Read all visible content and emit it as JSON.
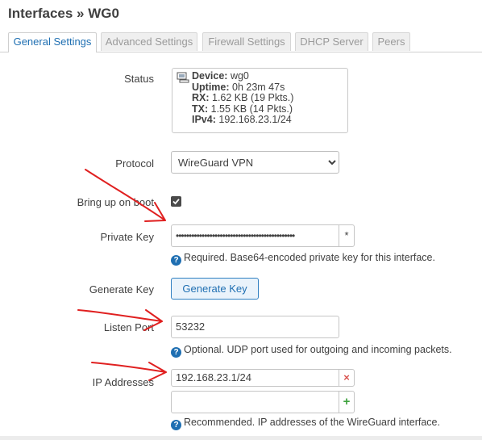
{
  "page": {
    "title": "Interfaces » WG0"
  },
  "tabs": [
    {
      "label": "General Settings",
      "active": true
    },
    {
      "label": "Advanced Settings",
      "active": false
    },
    {
      "label": "Firewall Settings",
      "active": false
    },
    {
      "label": "DHCP Server",
      "active": false
    },
    {
      "label": "Peers",
      "active": false
    }
  ],
  "status": {
    "label": "Status",
    "device_key": "Device:",
    "device_val": " wg0",
    "uptime_key": "Uptime:",
    "uptime_val": " 0h 23m 47s",
    "rx_key": "RX:",
    "rx_val": " 1.62 KB (19 Pkts.)",
    "tx_key": "TX:",
    "tx_val": " 1.55 KB (14 Pkts.)",
    "ipv4_key": "IPv4:",
    "ipv4_val": " 192.168.23.1/24"
  },
  "protocol": {
    "label": "Protocol",
    "value": "WireGuard VPN"
  },
  "boot": {
    "label": "Bring up on boot",
    "checked": true
  },
  "private_key": {
    "label": "Private Key",
    "value": "••••••••••••••••••••••••••••••••••••••••••••••",
    "reveal": "*",
    "hint": "Required. Base64-encoded private key for this interface."
  },
  "generate_key": {
    "label": "Generate Key",
    "button": "Generate Key"
  },
  "listen_port": {
    "label": "Listen Port",
    "value": "53232",
    "hint": "Optional. UDP port used for outgoing and incoming packets."
  },
  "ip_addresses": {
    "label": "IP Addresses",
    "values": [
      "192.168.23.1/24"
    ],
    "new_value": "",
    "remove_icon": "×",
    "add_icon": "+",
    "hint": "Recommended. IP addresses of the WireGuard interface."
  },
  "colors": {
    "accent": "#1f6fb2",
    "annotation": "#e02020",
    "remove": "#d9534f",
    "add": "#3ea33e"
  },
  "help_icon": "?"
}
